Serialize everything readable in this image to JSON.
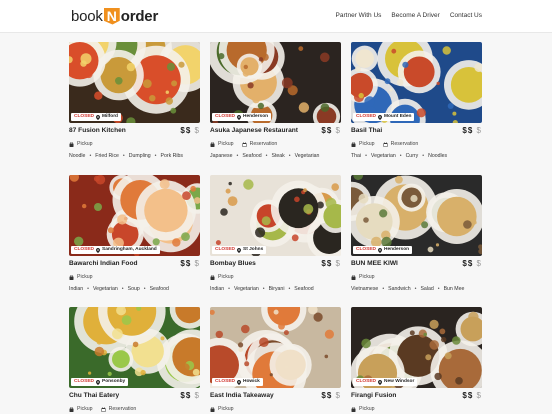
{
  "header": {
    "logo_left": "book",
    "logo_mid": "N",
    "logo_right": "order",
    "nav": [
      "Partner With Us",
      "Become A Driver",
      "Contact Us"
    ]
  },
  "colors": {
    "accent": "#f0901e",
    "closed": "#d0342c"
  },
  "restaurants": [
    {
      "name": "87 Fusion Kitchen",
      "status": "CLOSED",
      "location": "Milford",
      "price_active": "$$",
      "price_dim": "$",
      "modes": [
        "Pickup"
      ],
      "tags": [
        "Noodle",
        "Fried Rice",
        "Dumpling",
        "Pork Ribs"
      ]
    },
    {
      "name": "Asuka Japanese Restaurant",
      "status": "CLOSED",
      "location": "Henderson",
      "price_active": "$$",
      "price_dim": "$",
      "modes": [
        "Pickup",
        "Reservation"
      ],
      "tags": [
        "Japanese",
        "Seafood",
        "Steak",
        "Vegetarian"
      ]
    },
    {
      "name": "Basil Thai",
      "status": "CLOSED",
      "location": "Mount Eden",
      "price_active": "$$",
      "price_dim": "$",
      "modes": [
        "Pickup",
        "Reservation"
      ],
      "tags": [
        "Thai",
        "Vegetarian",
        "Curry",
        "Noodles"
      ]
    },
    {
      "name": "Bawarchi Indian Food",
      "status": "CLOSED",
      "location": "Sandringham, Auckland",
      "price_active": "$$",
      "price_dim": "$",
      "modes": [
        "Pickup"
      ],
      "tags": [
        "Indian",
        "Vegetarian",
        "Soup",
        "Seafood"
      ]
    },
    {
      "name": "Bombay Blues",
      "status": "CLOSED",
      "location": "St Johns",
      "price_active": "$$",
      "price_dim": "$",
      "modes": [
        "Pickup"
      ],
      "tags": [
        "Indian",
        "Vegetarian",
        "Biryani",
        "Seafood"
      ]
    },
    {
      "name": "BUN MEE KIWI",
      "status": "CLOSED",
      "location": "Henderson",
      "price_active": "$$",
      "price_dim": "$",
      "modes": [
        "Pickup"
      ],
      "tags": [
        "Vietnamese",
        "Sandwich",
        "Salad",
        "Bun Mee"
      ]
    },
    {
      "name": "Chu Thai Eatery",
      "status": "CLOSED",
      "location": "Ponsonby",
      "price_active": "$$",
      "price_dim": "$",
      "modes": [
        "Pickup",
        "Reservation"
      ],
      "tags": []
    },
    {
      "name": "East India Takeaway",
      "status": "CLOSED",
      "location": "Howick",
      "price_active": "$$",
      "price_dim": "$",
      "modes": [
        "Pickup"
      ],
      "tags": []
    },
    {
      "name": "Firangi Fusion",
      "status": "CLOSED",
      "location": "New Windsor",
      "price_active": "$$",
      "price_dim": "$",
      "modes": [
        "Pickup"
      ],
      "tags": []
    }
  ]
}
